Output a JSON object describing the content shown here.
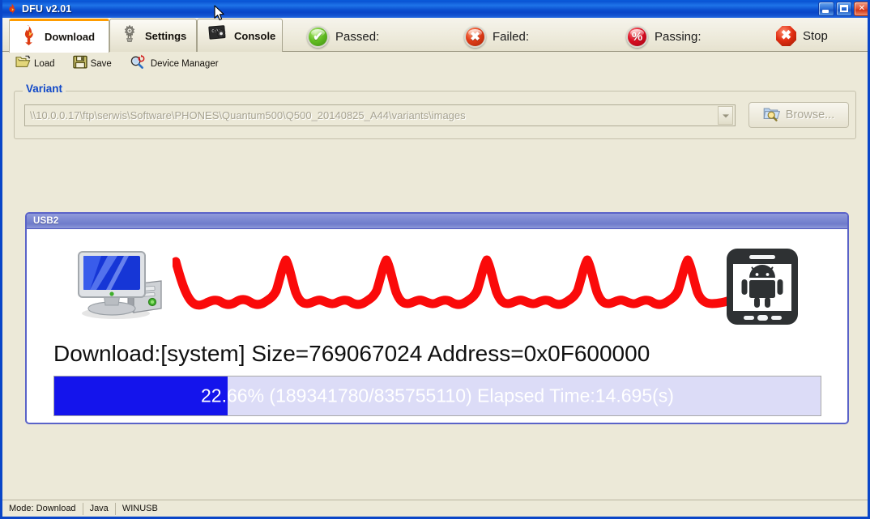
{
  "window": {
    "title": "DFU v2.01",
    "icon": "flame-icon",
    "controls": {
      "minimize": "minimize-button",
      "maximize": "maximize-button",
      "close": "close-button"
    }
  },
  "tabs": [
    {
      "label": "Download",
      "icon": "flame-icon",
      "active": true
    },
    {
      "label": "Settings",
      "icon": "gear-icon",
      "active": false
    },
    {
      "label": "Console",
      "icon": "console-icon",
      "active": false
    }
  ],
  "status_indicators": [
    {
      "label": "Passed:",
      "value": "",
      "icon": "check-circle-icon",
      "color": "#63bf23"
    },
    {
      "label": "Failed:",
      "value": "",
      "icon": "x-circle-icon",
      "color": "#e23c18"
    },
    {
      "label": "Passing:",
      "value": "",
      "icon": "percent-circle-icon",
      "color": "#dc0d22"
    },
    {
      "label": "Stop",
      "value": "",
      "icon": "stop-octagon-icon",
      "color": "#e02d12"
    }
  ],
  "toolbar": {
    "load_label": "Load",
    "save_label": "Save",
    "device_manager_label": "Device Manager"
  },
  "variant": {
    "group_title": "Variant",
    "path": "\\\\10.0.0.17\\ftp\\serwis\\Software\\PHONES\\Quantum500\\Q500_20140825_A44\\variants\\images",
    "placeholder": "",
    "browse_label": "Browse...",
    "disabled": true
  },
  "usb_panel": {
    "title": "USB2",
    "download_text": "Download:[system] Size=769067024 Address=0x0F600000",
    "progress": {
      "percent": 22.66,
      "text": "22.66% (189341780/835755110) Elapsed Time:14.695(s)",
      "bytes_done": "189341780",
      "bytes_total": "835755110",
      "elapsed": "14.695(s)",
      "fill_color": "#1414ec",
      "track_color": "#dcdcf7"
    },
    "left_icon": "desktop-computer-icon",
    "right_icon": "android-phone-icon",
    "waveform_icon": "heartbeat-waveform-icon",
    "waveform_color": "#fa0a0a"
  },
  "statusbar": {
    "cells": [
      "Mode: Download",
      "Java",
      "WINUSB"
    ]
  }
}
